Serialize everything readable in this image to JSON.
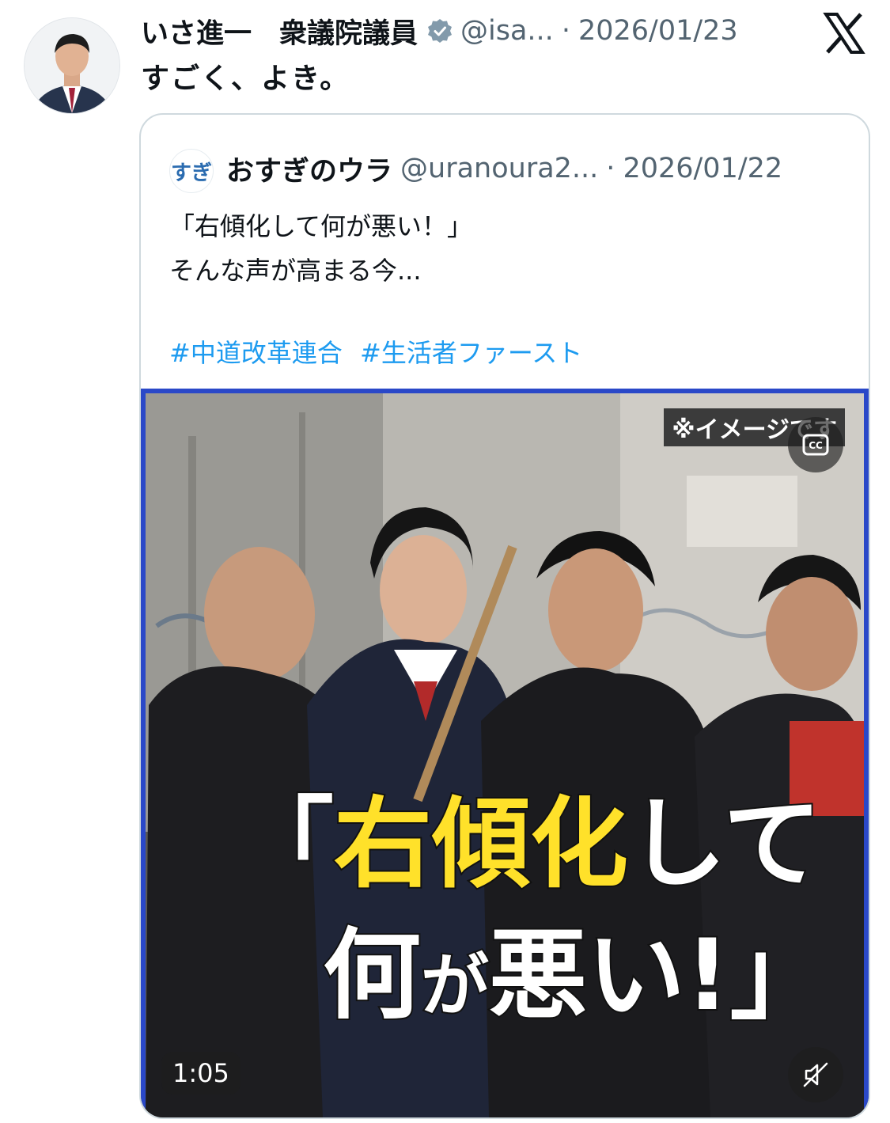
{
  "tweet": {
    "author_name": "いさ進一　衆議院議員",
    "handle": "@isa...",
    "separator": "·",
    "date": "2026/01/23",
    "text": "すごく、よき。",
    "verified": true
  },
  "quoted_tweet": {
    "avatar_text": "すぎ",
    "author_name": "おすぎのウラ",
    "handle": "@uranoura2...",
    "separator": "·",
    "date": "2026/01/22",
    "lines": [
      "「右傾化して何が悪い！」",
      "そんな声が高まる今..."
    ],
    "hashtags": [
      "#中道改革連合",
      "#生活者ファースト"
    ],
    "video": {
      "top_overlay": "※イメージです",
      "caption_line1_yellow": "右傾化",
      "caption_line1_prefix": "「",
      "caption_line1_suffix": "して",
      "caption_line2_a": "何",
      "caption_line2_b": "が",
      "caption_line2_c": "悪い!」",
      "duration": "1:05"
    }
  },
  "icons": {
    "verified": "verified-badge-icon",
    "platform": "x-logo-icon",
    "captions": "closed-captions-icon",
    "mute": "muted-speaker-icon"
  },
  "colors": {
    "link": "#1d9bf0",
    "caption_yellow": "#ffe12a",
    "secondary_text": "#536471"
  }
}
